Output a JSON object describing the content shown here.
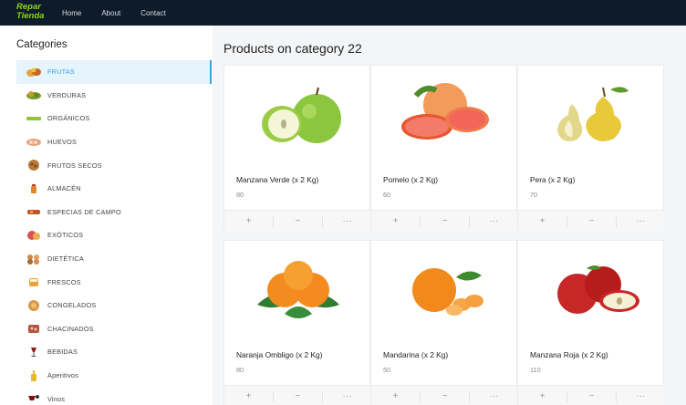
{
  "navbar": {
    "logo_line1": "Repar",
    "logo_line2": "Tienda",
    "links": [
      "Home",
      "About",
      "Contact"
    ]
  },
  "sidebar": {
    "title": "Categories",
    "items": [
      {
        "label": "FRUTAS",
        "icon": "fruits-icon",
        "active": true
      },
      {
        "label": "VERDURAS",
        "icon": "vegetables-icon"
      },
      {
        "label": "ORGÁNICOS",
        "icon": "organic-icon"
      },
      {
        "label": "HUEVOS",
        "icon": "eggs-icon"
      },
      {
        "label": "FRUTOS SECOS",
        "icon": "nuts-icon"
      },
      {
        "label": "ALMACÉN",
        "icon": "pantry-icon"
      },
      {
        "label": "ESPECIAS DE CAMPO",
        "icon": "spices-icon"
      },
      {
        "label": "EXÓTICOS",
        "icon": "exotic-icon"
      },
      {
        "label": "DIETÉTICA",
        "icon": "dietetic-icon"
      },
      {
        "label": "FRESCOS",
        "icon": "fresh-icon"
      },
      {
        "label": "CONGELADOS",
        "icon": "frozen-icon"
      },
      {
        "label": "CHACINADOS",
        "icon": "cold-cuts-icon"
      },
      {
        "label": "BEBIDAS",
        "icon": "drinks-icon"
      },
      {
        "label": "Aperitivos",
        "icon": "appetizers-icon"
      },
      {
        "label": "Vinos",
        "icon": "wine-icon"
      }
    ]
  },
  "main": {
    "title": "Products on category 22",
    "products": [
      {
        "name": "Manzana Verde (x 2 Kg)",
        "price": "80",
        "icon": "green-apple-icon"
      },
      {
        "name": "Pomelo (x 2 Kg)",
        "price": "60",
        "icon": "grapefruit-icon"
      },
      {
        "name": "Pera (x 2 Kg)",
        "price": "70",
        "icon": "pear-icon"
      },
      {
        "name": "Naranja Ombligo (x 2 Kg)",
        "price": "80",
        "icon": "orange-icon"
      },
      {
        "name": "Mandarina (x 2 Kg)",
        "price": "50",
        "icon": "mandarin-icon"
      },
      {
        "name": "Manzana Roja (x 2 Kg)",
        "price": "110",
        "icon": "red-apple-icon"
      }
    ],
    "actions": {
      "add": "+",
      "remove": "−",
      "more": "···"
    }
  },
  "colors": {
    "navbar": "#0d1b2a",
    "logo": "#8bd61b",
    "accent": "#3aa0e6",
    "active_bg": "#e6f4fc"
  }
}
